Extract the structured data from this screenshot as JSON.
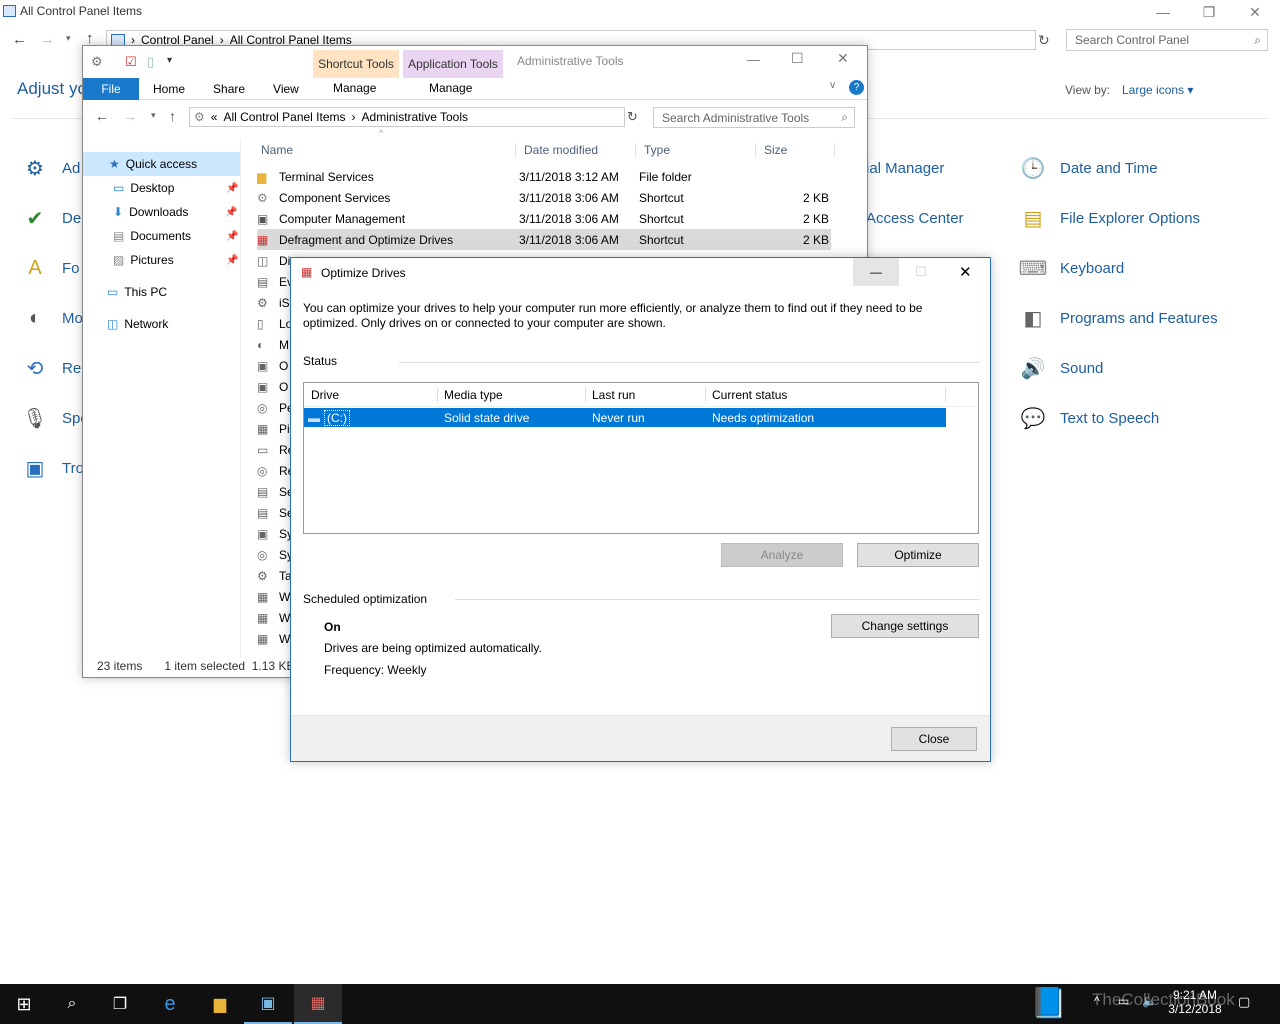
{
  "control_panel": {
    "title": "All Control Panel Items",
    "breadcrumb": [
      "Control Panel",
      "All Control Panel Items"
    ],
    "search_placeholder": "Search Control Panel",
    "heading": "Adjust yo",
    "view_by_label": "View by:",
    "view_by_value": "Large icons",
    "items_left": [
      "Ad",
      "De",
      "Fo",
      "Mo",
      "Re",
      "Spe",
      "Tro"
    ],
    "items_mid": [
      "ial Manager",
      "Access Center"
    ],
    "items_right": [
      "Date and Time",
      "File Explorer Options",
      "Keyboard",
      "Programs and Features",
      "Sound",
      "Text to Speech"
    ]
  },
  "explorer": {
    "title": "Administrative Tools",
    "context_tabs": [
      "Shortcut Tools",
      "Application Tools"
    ],
    "manage": "Manage",
    "tabs": [
      "File",
      "Home",
      "Share",
      "View"
    ],
    "breadcrumb": [
      "All Control Panel Items",
      "Administrative Tools"
    ],
    "search_placeholder": "Search Administrative Tools",
    "nav": {
      "quick_access": "Quick access",
      "pinned": [
        "Desktop",
        "Downloads",
        "Documents",
        "Pictures"
      ],
      "this_pc": "This PC",
      "network": "Network"
    },
    "columns": [
      "Name",
      "Date modified",
      "Type",
      "Size"
    ],
    "rows": [
      {
        "name": "Terminal Services",
        "date": "3/11/2018 3:12 AM",
        "type": "File folder",
        "size": ""
      },
      {
        "name": "Component Services",
        "date": "3/11/2018 3:06 AM",
        "type": "Shortcut",
        "size": "2 KB"
      },
      {
        "name": "Computer Management",
        "date": "3/11/2018 3:06 AM",
        "type": "Shortcut",
        "size": "2 KB"
      },
      {
        "name": "Defragment and Optimize Drives",
        "date": "3/11/2018 3:06 AM",
        "type": "Shortcut",
        "size": "2 KB"
      }
    ],
    "partial_rows": [
      "Di",
      "Ev",
      "iS",
      "Lo",
      "M",
      "O",
      "O",
      "Pe",
      "Pi",
      "Re",
      "Re",
      "Se",
      "Se",
      "Sy",
      "Sy",
      "Ta",
      "W",
      "W",
      "W"
    ],
    "status_items": "23 items",
    "status_selected": "1 item selected",
    "status_size": "1.13 KB"
  },
  "optimize": {
    "title": "Optimize Drives",
    "description": "You can optimize your drives to help your computer run more efficiently, or analyze them to find out if they need to be optimized. Only drives on or connected to your computer are shown.",
    "status_label": "Status",
    "columns": [
      "Drive",
      "Media type",
      "Last run",
      "Current status"
    ],
    "drive": {
      "name": "(C:)",
      "media": "Solid state drive",
      "last_run": "Never run",
      "status": "Needs optimization"
    },
    "analyze": "Analyze",
    "optimize": "Optimize",
    "scheduled_label": "Scheduled optimization",
    "sched_state": "On",
    "sched_desc": "Drives are being optimized automatically.",
    "sched_freq": "Frequency: Weekly",
    "change_settings": "Change settings",
    "close": "Close"
  },
  "taskbar": {
    "time": "9:21 AM",
    "date": "3/12/2018",
    "watermark": "TheCollectionBook"
  },
  "colors": {
    "selection": "#0078d7",
    "accent": "#1e5e9e",
    "shortcut_tools": "#fde3c1",
    "app_tools": "#e9d4f2"
  }
}
